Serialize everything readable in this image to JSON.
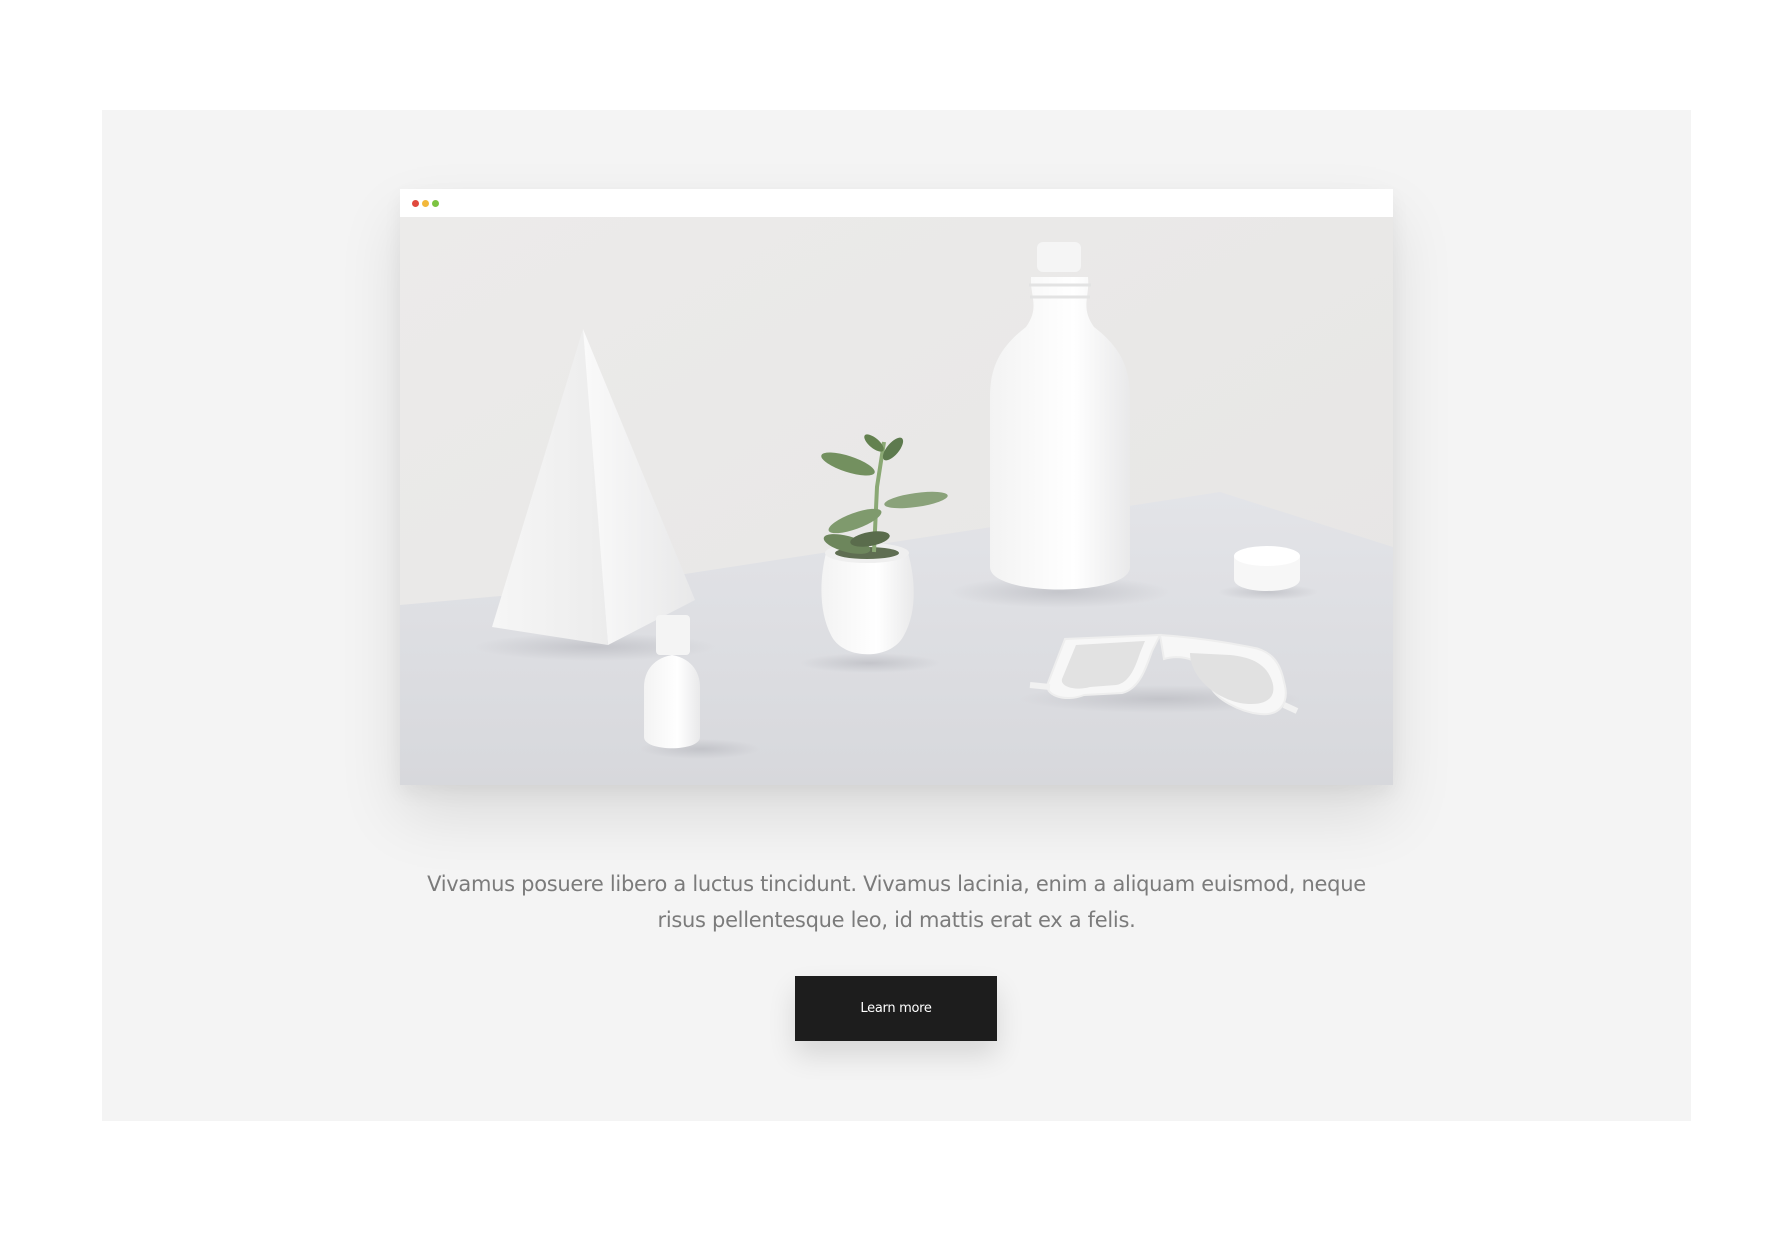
{
  "browser_mockup": {
    "window_dots": [
      "#e0493d",
      "#f2b83b",
      "#7cc341"
    ],
    "image": {
      "description_icons": [
        "pyramid",
        "small-bottle",
        "plant-pot",
        "large-bottle",
        "bottle-cap",
        "sunglasses"
      ]
    }
  },
  "content": {
    "paragraph": "Vivamus posuere libero a luctus tincidunt. Vivamus lacinia, enim a aliquam euismod, neque risus pellentesque leo, id mattis erat ex a felis.",
    "button_label": "Learn more"
  },
  "colors": {
    "section_bg": "#f4f4f4",
    "button_bg": "#1d1d1d",
    "text": "#7b7b7b"
  }
}
